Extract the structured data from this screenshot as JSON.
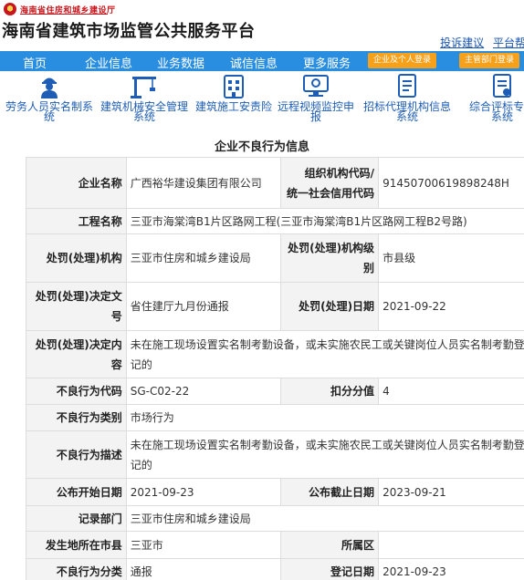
{
  "header": {
    "department": "海南省住房和城乡建设厅",
    "title": "海南省建筑市场监管公共服务平台",
    "links": [
      "投诉建议",
      "平台帮"
    ]
  },
  "nav": {
    "items": [
      "首页",
      "企业信息",
      "业务数据",
      "诚信信息",
      "更多服务"
    ],
    "buttons": [
      "企业及个人登录",
      "主管部门登录"
    ]
  },
  "iconbar": {
    "items": [
      {
        "label_line1": "劳务人员实名制系",
        "label_line2": "统",
        "icon": "worker-icon"
      },
      {
        "label_line1": "建筑机械安全管理",
        "label_line2": "系统",
        "icon": "crane-icon"
      },
      {
        "label_line1": "建筑施工安责险",
        "label_line2": "",
        "icon": "building-insurance-icon"
      },
      {
        "label_line1": "远程视频监控申",
        "label_line2": "报",
        "icon": "video-monitor-icon"
      },
      {
        "label_line1": "招标代理机构信息",
        "label_line2": "系统",
        "icon": "document-icon"
      },
      {
        "label_line1": "综合评标专家",
        "label_line2": "系统",
        "icon": "expert-icon"
      }
    ]
  },
  "section_title": "企业不良行为信息",
  "record": {
    "company_name_label": "企业名称",
    "company_name": "广西裕华建设集团有限公司",
    "org_code_label_1": "组织机构代码/",
    "org_code_label_2": "统一社会信用代码",
    "org_code": "91450700619898248H",
    "project_label": "工程名称",
    "project": "三亚市海棠湾B1片区路网工程(三亚市海棠湾B1片区路网工程B2号路)",
    "authority_label": "处罚(处理)机构",
    "authority": "三亚市住房和城乡建设局",
    "authority_level_label": "处罚(处理)机构级别",
    "authority_level": "市县级",
    "decision_no_label": "处罚(处理)决定文号",
    "decision_no": "省住建厅九月份通报",
    "date_label": "处罚(处理)日期",
    "date": "2021-09-22",
    "decision_content_label": "处罚(处理)决定内容",
    "decision_content": "未在施工现场设置实名制考勤设备，或未实施农民工或关键岗位人员实名制考勤登记的",
    "code_label": "不良行为代码",
    "code": "SG-C02-22",
    "score_label": "扣分分值",
    "score": "4",
    "category_label": "不良行为类别",
    "category": "市场行为",
    "description_label": "不良行为描述",
    "description": "未在施工现场设置实名制考勤设备，或未实施农民工或关键岗位人员实名制考勤登记的",
    "pub_start_label": "公布开始日期",
    "pub_start": "2021-09-23",
    "pub_end_label": "公布截止日期",
    "pub_end": "2023-09-21",
    "record_dept_label": "记录部门",
    "record_dept": "三亚市住房和城乡建设局",
    "city_label": "发生地所在市县",
    "city": "三亚市",
    "district_label": "所属区",
    "district": "",
    "classification_label": "不良行为分类",
    "classification": "通报",
    "register_date_label": "登记日期",
    "register_date": "2021-09-23"
  },
  "colors": {
    "nav_bg": "#2a8ee0",
    "login_button": "#f7a11a",
    "link": "#1a55b0",
    "icon": "#1d5db5",
    "label_bg": "#f3f3f3"
  }
}
